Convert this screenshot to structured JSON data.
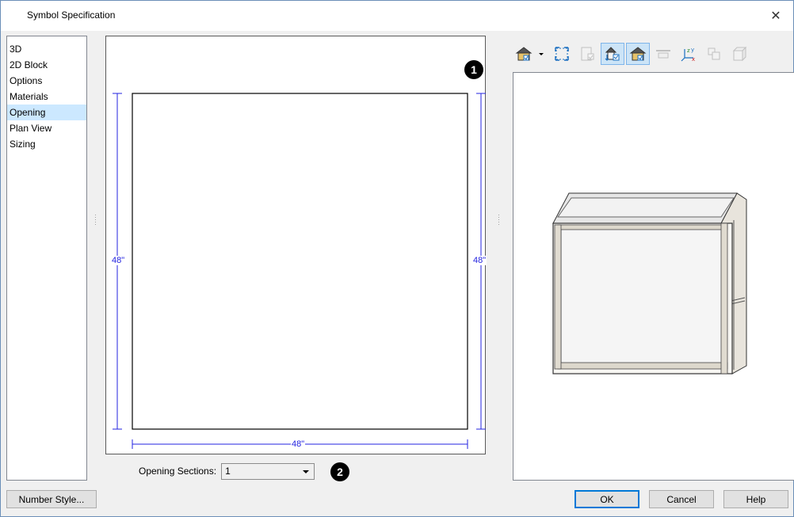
{
  "window": {
    "title": "Symbol Specification",
    "close_glyph": "✕"
  },
  "categories": [
    {
      "label": "3D",
      "selected": false
    },
    {
      "label": "2D Block",
      "selected": false
    },
    {
      "label": "Options",
      "selected": false
    },
    {
      "label": "Materials",
      "selected": false
    },
    {
      "label": "Opening",
      "selected": true
    },
    {
      "label": "Plan View",
      "selected": false
    },
    {
      "label": "Sizing",
      "selected": false
    }
  ],
  "preview2d": {
    "callout": "1",
    "dimensions": {
      "left": "48\"",
      "right": "48\"",
      "bottom": "48\""
    },
    "dimension_color": "#2323e0"
  },
  "opening_sections": {
    "label": "Opening Sections:",
    "value": "1",
    "callout": "2"
  },
  "toolbar": {
    "buttons": [
      {
        "icon": "camera-view-icon",
        "active": false,
        "disabled": false,
        "has_dropdown": true
      },
      {
        "icon": "fill-window-icon",
        "active": false,
        "disabled": false
      },
      {
        "icon": "show-door-swing-icon",
        "active": false,
        "disabled": true
      },
      {
        "icon": "show-cross-section-icon",
        "active": true,
        "disabled": false
      },
      {
        "icon": "show-materials-icon",
        "active": true,
        "disabled": false
      },
      {
        "icon": "show-horizon-icon",
        "active": false,
        "disabled": true
      },
      {
        "icon": "xyz-axis-icon",
        "active": false,
        "disabled": false
      },
      {
        "icon": "symbol-origin-icon",
        "active": false,
        "disabled": true
      },
      {
        "icon": "bounding-box-icon",
        "active": false,
        "disabled": true
      }
    ]
  },
  "buttons": {
    "number_style": "Number Style...",
    "ok": "OK",
    "cancel": "Cancel",
    "help": "Help"
  },
  "colors": {
    "accent": "#0078d7",
    "selection": "#cce8ff",
    "dimension": "#2323e0"
  }
}
